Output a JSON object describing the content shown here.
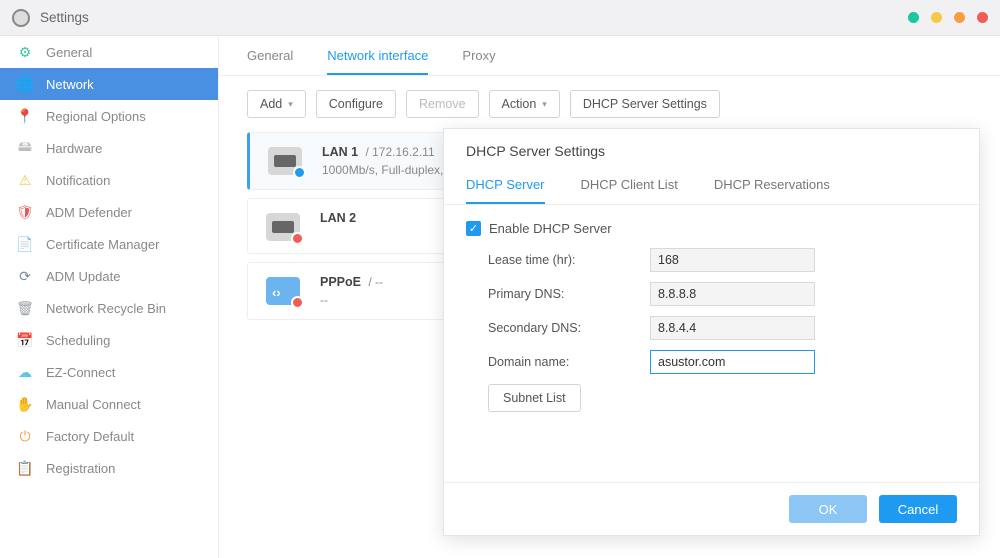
{
  "window": {
    "title": "Settings"
  },
  "sidebar": {
    "items": [
      {
        "label": "General",
        "icon": "⚙",
        "cls": "ic-general"
      },
      {
        "label": "Network",
        "icon": "🌐",
        "cls": "ic-network",
        "active": true
      },
      {
        "label": "Regional Options",
        "icon": "📍",
        "cls": "ic-regional"
      },
      {
        "label": "Hardware",
        "icon": "🖴",
        "cls": "ic-hardware"
      },
      {
        "label": "Notification",
        "icon": "⚠",
        "cls": "ic-notif"
      },
      {
        "label": "ADM Defender",
        "icon": "🛡",
        "cls": "ic-adm"
      },
      {
        "label": "Certificate Manager",
        "icon": "📄",
        "cls": "ic-cert"
      },
      {
        "label": "ADM Update",
        "icon": "⟳",
        "cls": "ic-update"
      },
      {
        "label": "Network Recycle Bin",
        "icon": "🗑",
        "cls": "ic-recycle"
      },
      {
        "label": "Scheduling",
        "icon": "📅",
        "cls": "ic-sched"
      },
      {
        "label": "EZ-Connect",
        "icon": "☁",
        "cls": "ic-ez"
      },
      {
        "label": "Manual Connect",
        "icon": "✋",
        "cls": "ic-manual"
      },
      {
        "label": "Factory Default",
        "icon": "⏻",
        "cls": "ic-factory"
      },
      {
        "label": "Registration",
        "icon": "📋",
        "cls": "ic-reg"
      }
    ]
  },
  "tabs": {
    "general": "General",
    "network_interface": "Network interface",
    "proxy": "Proxy"
  },
  "toolbar": {
    "add": "Add",
    "configure": "Configure",
    "remove": "Remove",
    "action": "Action",
    "dhcp": "DHCP Server Settings"
  },
  "ifaces": [
    {
      "name": "LAN 1",
      "ip": "172.16.2.11",
      "sub": "1000Mb/s, Full-duplex,",
      "status": "ok",
      "selected": true
    },
    {
      "name": "LAN 2",
      "ip": "",
      "sub": "",
      "status": "off"
    },
    {
      "name": "PPPoE",
      "ip": "--",
      "sub": "--",
      "status": "off",
      "pppoe": true
    }
  ],
  "dialog": {
    "title": "DHCP Server Settings",
    "tabs": {
      "server": "DHCP Server",
      "client": "DHCP Client List",
      "res": "DHCP Reservations"
    },
    "enable_label": "Enable DHCP Server",
    "enable_checked": true,
    "fields": {
      "lease": {
        "label": "Lease time (hr):",
        "value": "168"
      },
      "primary": {
        "label": "Primary DNS:",
        "value": "8.8.8.8"
      },
      "secondary": {
        "label": "Secondary DNS:",
        "value": "8.8.4.4"
      },
      "domain": {
        "label": "Domain name:",
        "value": "asustor.com"
      }
    },
    "subnet_list": "Subnet List",
    "ok": "OK",
    "cancel": "Cancel"
  }
}
